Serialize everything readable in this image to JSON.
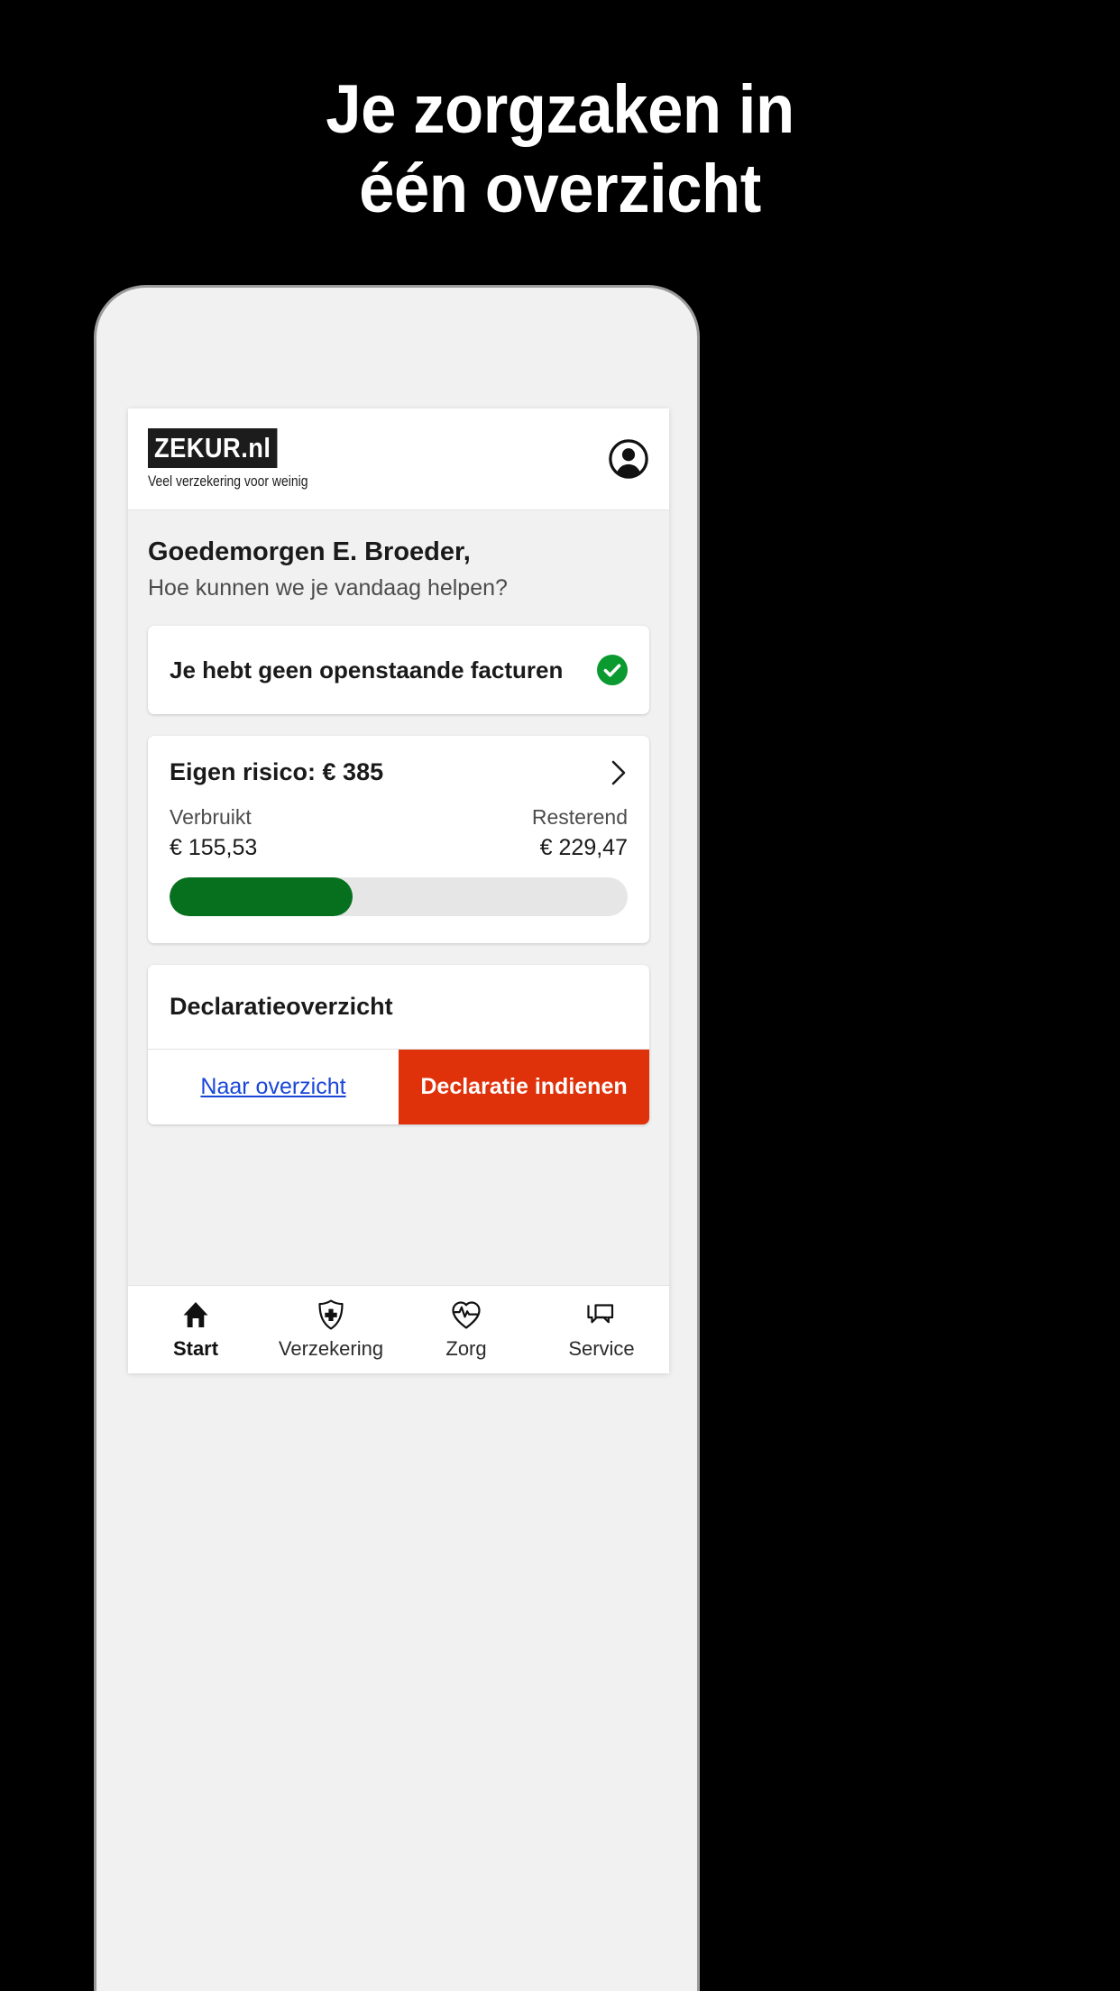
{
  "hero": {
    "line1": "Je zorgzaken in",
    "line2": "één overzicht"
  },
  "app": {
    "logo": {
      "mark": "ZEKUR.nl",
      "tagline": "Veel verzekering voor weinig"
    },
    "profile_icon": "person-circle-icon",
    "greeting": {
      "title": "Goedemorgen E. Broeder,",
      "subtitle": "Hoe kunnen we je vandaag helpen?"
    },
    "invoice_card": {
      "text": "Je hebt geen openstaande facturen",
      "status_icon": "check-circle-icon",
      "status_color": "#0a9a2f"
    },
    "risk_card": {
      "title": "Eigen risico: € 385",
      "chevron_icon": "chevron-right-icon",
      "used_label": "Verbruikt",
      "used_value": "€ 155,53",
      "remaining_label": "Resterend",
      "remaining_value": "€ 229,47",
      "progress_percent": 40,
      "progress_color": "#07701f",
      "track_color": "#e6e6e6"
    },
    "declaration_card": {
      "title": "Declaratieoverzicht",
      "link_label": "Naar overzicht",
      "link_color": "#1a46d8",
      "button_label": "Declaratie indienen",
      "button_color": "#e0320a"
    },
    "bottom_nav": [
      {
        "label": "Start",
        "icon": "home-icon",
        "active": true
      },
      {
        "label": "Verzekering",
        "icon": "shield-plus-icon",
        "active": false
      },
      {
        "label": "Zorg",
        "icon": "heart-pulse-icon",
        "active": false
      },
      {
        "label": "Service",
        "icon": "chat-bubbles-icon",
        "active": false
      }
    ]
  }
}
